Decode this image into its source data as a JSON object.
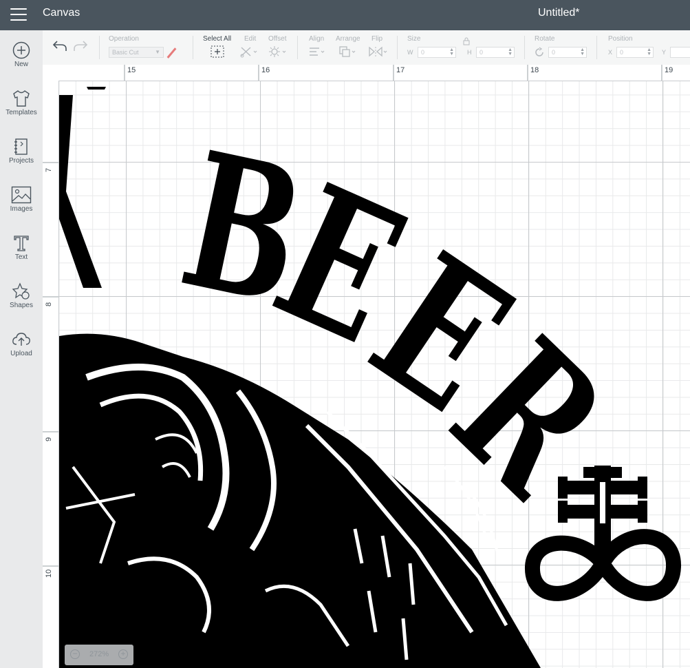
{
  "header": {
    "app_title": "Canvas",
    "document_title": "Untitled*"
  },
  "leftnav": {
    "items": [
      {
        "label": "New",
        "icon": "plus-circle-icon"
      },
      {
        "label": "Templates",
        "icon": "tshirt-icon"
      },
      {
        "label": "Projects",
        "icon": "notebook-icon"
      },
      {
        "label": "Images",
        "icon": "image-icon"
      },
      {
        "label": "Text",
        "icon": "text-icon"
      },
      {
        "label": "Shapes",
        "icon": "shapes-icon"
      },
      {
        "label": "Upload",
        "icon": "cloud-upload-icon"
      }
    ]
  },
  "toolbar": {
    "operation_label": "Operation",
    "operation_value": "Basic Cut",
    "select_all_label": "Select All",
    "edit_label": "Edit",
    "offset_label": "Offset",
    "align_label": "Align",
    "arrange_label": "Arrange",
    "flip_label": "Flip",
    "size_label": "Size",
    "size_w_prefix": "W",
    "size_w_value": "0",
    "size_h_prefix": "H",
    "size_h_value": "0",
    "rotate_label": "Rotate",
    "rotate_value": "0",
    "position_label": "Position",
    "position_x_prefix": "X",
    "position_x_value": "0",
    "position_y_prefix": "Y"
  },
  "ruler": {
    "top_numbers": [
      "15",
      "16",
      "17",
      "18",
      "19"
    ],
    "left_numbers": [
      "7",
      "8",
      "9",
      "10"
    ]
  },
  "canvas": {
    "artwork_text": "BEER"
  },
  "zoom": {
    "value": "272%"
  },
  "colors": {
    "topbar": "#4a555e",
    "leftnav": "#e9eaeb",
    "toolbar": "#f5f6f6",
    "ink": "#000000"
  }
}
